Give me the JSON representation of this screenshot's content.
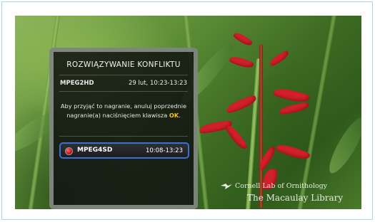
{
  "dialog": {
    "title": "ROZWIĄZYWANIE KONFLIKTU",
    "channel": "MPEG2HD",
    "channel_time": "29 lut, 10:23-13:23",
    "message_part1": "Aby przyjąć to nagranie, anuluj poprzednie nagranie(a) naciśnięciem klawisza ",
    "message_ok": "OK",
    "message_end": ".",
    "options": [
      {
        "name": "MPEG4SD",
        "time": "10:08-13:23",
        "icon": "record-icon"
      }
    ]
  },
  "watermark": {
    "line1": "Cornell Lab of Ornithology",
    "line2": "The Macaulay Library",
    "icon": "bird-icon"
  },
  "colors": {
    "accent_border": "#3b6fd3",
    "ok_highlight": "#f2c21d",
    "record": "#c3141c",
    "frame_border": "#a6d8ea"
  }
}
